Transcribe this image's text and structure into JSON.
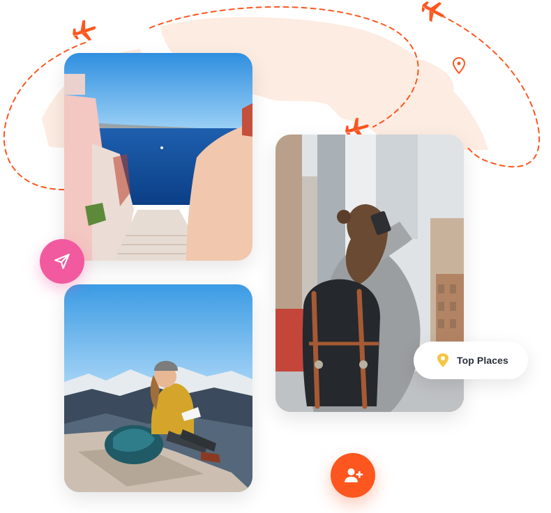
{
  "colors": {
    "accent": "#fd561f",
    "send_button": "#f25aa0",
    "route": "#fd561f",
    "map": "#fde9dc",
    "pin": "#f5c542"
  },
  "icons": {
    "airplane": "airplane-icon",
    "location_pin": "location-pin-icon",
    "send": "send-icon",
    "add_user": "add-user-icon"
  },
  "photos": [
    {
      "name": "santorini-stairs-photo"
    },
    {
      "name": "hiker-sketching-photo"
    },
    {
      "name": "traveler-photographing-city-photo"
    }
  ],
  "chip": {
    "label": "Top Places"
  }
}
